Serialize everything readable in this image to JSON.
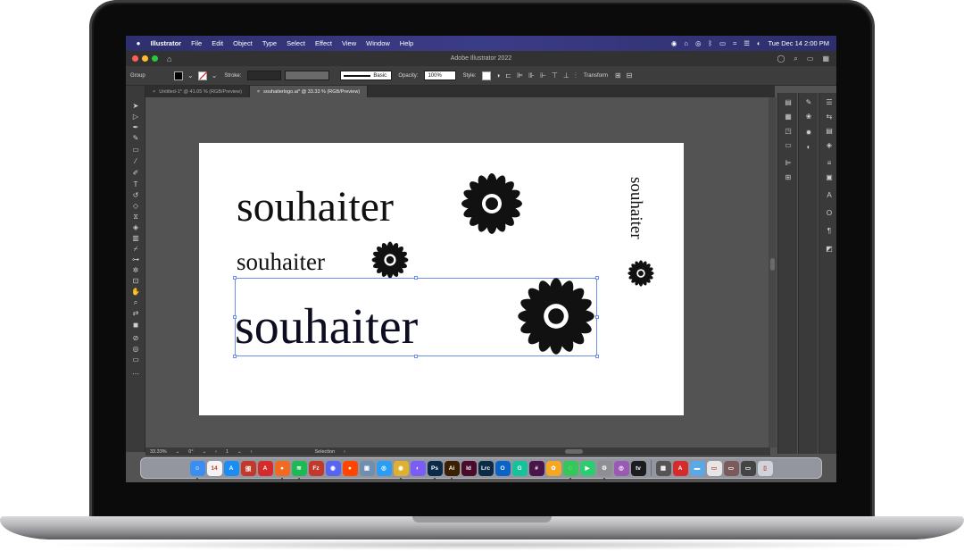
{
  "menubar": {
    "app_name": "Illustrator",
    "items": [
      "File",
      "Edit",
      "Object",
      "Type",
      "Select",
      "Effect",
      "View",
      "Window",
      "Help"
    ],
    "clock": "Tue Dec 14  2:00 PM"
  },
  "window": {
    "title": "Adobe Illustrator 2022"
  },
  "controlbar": {
    "selection_type": "Group",
    "stroke_label": "Stroke:",
    "brush_label": "Basic",
    "opacity_label": "Opacity:",
    "opacity_value": "100%",
    "style_label": "Style:",
    "transform_label": "Transform"
  },
  "tabs": [
    {
      "label": "Untitled-1* @ 41.05 % (RGB/Preview)",
      "close": "×"
    },
    {
      "label": "souhaiterlogo.ai* @ 33.33 % (RGB/Preview)",
      "close": "×"
    }
  ],
  "statusbar": {
    "zoom": "33.33%",
    "rotation": "0°",
    "artboard_number": "1",
    "tool_name": "Selection"
  },
  "artboard": {
    "logo_1": "souhaiter",
    "logo_2": "souhaiter",
    "logo_3": "souhaiter",
    "logo_vertical": "souhaiter"
  },
  "dock": {
    "calendar_day": "14",
    "apps": [
      {
        "label": "Finder",
        "glyph": "☺",
        "color": "#3a8ef0"
      },
      {
        "label": "Calendar",
        "glyph": "14",
        "color": "#f4f4f4"
      },
      {
        "label": "App Store",
        "glyph": "A",
        "color": "#1c8cf5"
      },
      {
        "label": "Dictionary",
        "glyph": "頒",
        "color": "#c0392b"
      },
      {
        "label": "Acrobat",
        "glyph": "A",
        "color": "#d62b2b"
      },
      {
        "label": "Firefox",
        "glyph": "●",
        "color": "#f26a21"
      },
      {
        "label": "Spotify",
        "glyph": "≋",
        "color": "#1db954"
      },
      {
        "label": "FileZilla",
        "glyph": "Fz",
        "color": "#c0392b"
      },
      {
        "label": "Discord",
        "glyph": "◉",
        "color": "#5865f2"
      },
      {
        "label": "Reddit",
        "glyph": "●",
        "color": "#ff4500"
      },
      {
        "label": "Preview",
        "glyph": "▣",
        "color": "#6f8fb0"
      },
      {
        "label": "Safari",
        "glyph": "◎",
        "color": "#2a9df4"
      },
      {
        "label": "Chrome",
        "glyph": "◉",
        "color": "#e0b030"
      },
      {
        "label": "Messenger",
        "glyph": "◐",
        "color": "#7b5cf5"
      },
      {
        "label": "Photoshop",
        "glyph": "Ps",
        "color": "#0b2a4a"
      },
      {
        "label": "Illustrator",
        "glyph": "Ai",
        "color": "#3a1f00"
      },
      {
        "label": "InDesign",
        "glyph": "Id",
        "color": "#4a0a2a"
      },
      {
        "label": "Lightroom Classic",
        "glyph": "Lrc",
        "color": "#0c2c45"
      },
      {
        "label": "Outlook",
        "glyph": "O",
        "color": "#0a64c8"
      },
      {
        "label": "Grammarly",
        "glyph": "G",
        "color": "#15c39a"
      },
      {
        "label": "Slack",
        "glyph": "#",
        "color": "#4a154b"
      },
      {
        "label": "Photos",
        "glyph": "✿",
        "color": "#f5a623"
      },
      {
        "label": "Messages",
        "glyph": "◌",
        "color": "#34c759"
      },
      {
        "label": "Facetime",
        "glyph": "▶",
        "color": "#2ecc71"
      },
      {
        "label": "Settings",
        "glyph": "⚙",
        "color": "#8e8e93"
      },
      {
        "label": "Podcasts",
        "glyph": "◎",
        "color": "#9b59b6"
      },
      {
        "label": "TV",
        "glyph": "tv",
        "color": "#1c1c1e"
      }
    ],
    "apps_right": [
      {
        "label": "Calculator",
        "glyph": "▦",
        "color": "#555"
      },
      {
        "label": "PDF",
        "glyph": "A",
        "color": "#d62b2b"
      },
      {
        "label": "Folder",
        "glyph": "▬",
        "color": "#5aa9e6"
      },
      {
        "label": "Screenshot",
        "glyph": "▭",
        "color": "#e6e6e6"
      },
      {
        "label": "Window",
        "glyph": "▭",
        "color": "#7a5a5a"
      },
      {
        "label": "Window 2",
        "glyph": "▭",
        "color": "#444"
      },
      {
        "label": "Trash",
        "glyph": "▯",
        "color": "#d0d4da"
      }
    ]
  },
  "colors": {
    "menubar": "#3b3c86",
    "workspace": "#535353",
    "panel": "#3a3a3a",
    "selection": "#6b8ff0",
    "logo_ink": "#111111"
  }
}
